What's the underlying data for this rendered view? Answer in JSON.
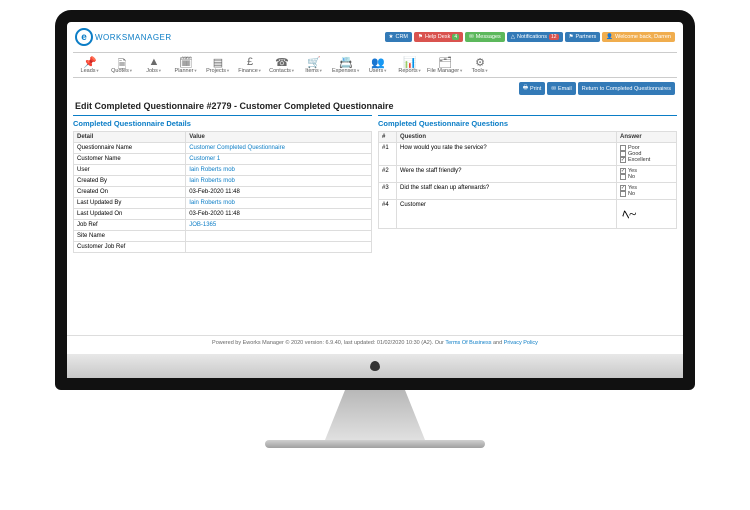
{
  "logo": {
    "letter": "e",
    "text": "WORKSMANAGER"
  },
  "topButtons": {
    "crm": "CRM",
    "help": "Help Desk",
    "helpBadge": "4",
    "msg": "Messages",
    "notif": "Notifications",
    "notifBadge": "12",
    "partners": "Partners",
    "welcome": "Welcome back, Darren"
  },
  "menu": [
    "Leads",
    "Quotes",
    "Jobs",
    "Planner",
    "Projects",
    "Finance",
    "Contacts",
    "Items",
    "Expenses",
    "Users",
    "Reports",
    "File Manager",
    "Tools"
  ],
  "menuIcons": [
    "📌",
    "🗎",
    "▲",
    "🗓",
    "▤",
    "£",
    "☎",
    "🛒",
    "📇",
    "👥",
    "📊",
    "🗂",
    "⚙"
  ],
  "actions": {
    "print": "Print",
    "email": "Email",
    "return": "Return to Completed Questionnaires"
  },
  "pageTitle": "Edit Completed Questionnaire #2779 - Customer Completed Questionnaire",
  "leftTitle": "Completed Questionnaire Details",
  "rightTitle": "Completed Questionnaire Questions",
  "detailHead": {
    "c1": "Detail",
    "c2": "Value"
  },
  "details": [
    {
      "k": "Questionnaire Name",
      "v": "Customer Completed Questionnaire",
      "link": true
    },
    {
      "k": "Customer Name",
      "v": "Customer 1",
      "link": true
    },
    {
      "k": "User",
      "v": "Iain Roberts mob",
      "link": true
    },
    {
      "k": "Created By",
      "v": "Iain Roberts mob",
      "link": true
    },
    {
      "k": "Created On",
      "v": "03-Feb-2020 11:48"
    },
    {
      "k": "Last Updated By",
      "v": "Iain Roberts mob",
      "link": true
    },
    {
      "k": "Last Updated On",
      "v": "03-Feb-2020 11:48"
    },
    {
      "k": "Job Ref",
      "v": "JOB-1365",
      "link": true
    },
    {
      "k": "Site Name",
      "v": ""
    },
    {
      "k": "Customer Job Ref",
      "v": ""
    }
  ],
  "qHead": {
    "c1": "#",
    "c2": "Question",
    "c3": "Answer"
  },
  "questions": [
    {
      "n": "#1",
      "q": "How would you rate the service?",
      "opts": [
        [
          "Poor",
          false
        ],
        [
          "Good",
          false
        ],
        [
          "Excellent",
          true
        ]
      ]
    },
    {
      "n": "#2",
      "q": "Were the staff friendly?",
      "opts": [
        [
          "Yes",
          true
        ],
        [
          "No",
          false
        ]
      ]
    },
    {
      "n": "#3",
      "q": "Did the staff clean up afterwards?",
      "opts": [
        [
          "Yes",
          true
        ],
        [
          "No",
          false
        ]
      ]
    },
    {
      "n": "#4",
      "q": "Customer",
      "sig": true
    }
  ],
  "footer": {
    "t1": "Powered by Eworks Manager © 2020 version: 6.9.40, last updated: 01/02/2020 10:30 (A2). Our ",
    "l1": "Terms Of Business",
    "t2": " and ",
    "l2": "Privacy Policy"
  }
}
